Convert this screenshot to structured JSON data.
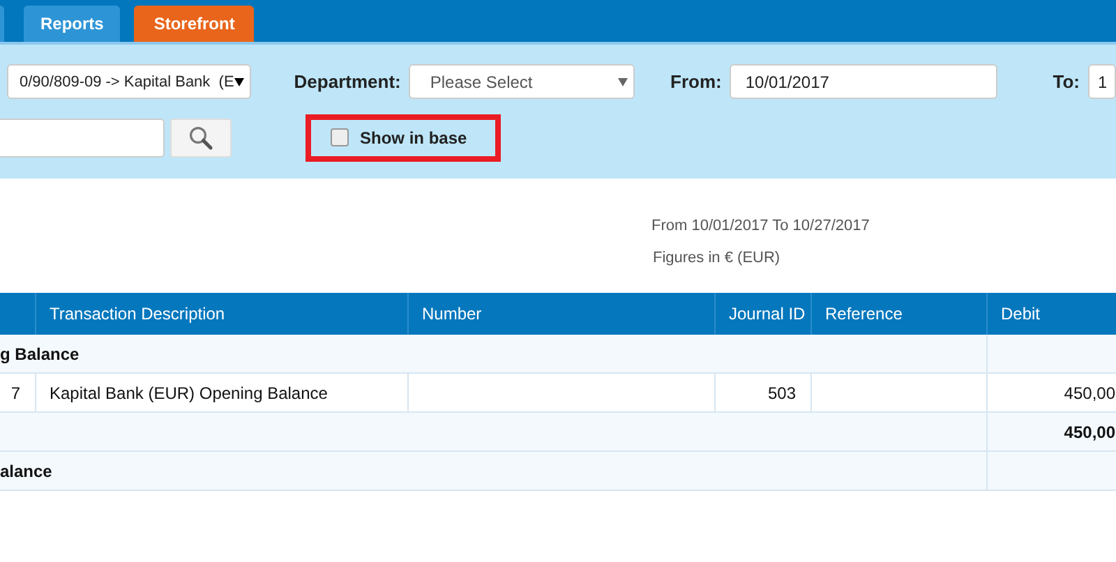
{
  "tabs": [
    {
      "selected": false
    },
    {
      "label": "Reports",
      "selected": false
    },
    {
      "label": "Storefront",
      "selected": true
    }
  ],
  "filters": {
    "account": {
      "value": "0/90/809-09 -> Kapital Bank  (E"
    },
    "department": {
      "label": "Department:",
      "value": "Please Select"
    },
    "from": {
      "label": "From:",
      "value": "10/01/2017"
    },
    "to": {
      "label": "To:",
      "value": "1"
    },
    "show_in_base": {
      "label": "Show in base",
      "checked": false,
      "highlighted": true
    }
  },
  "report": {
    "period": "From 10/01/2017 To 10/27/2017",
    "currency": "Figures in € (EUR)"
  },
  "table": {
    "columns": [
      "",
      "Transaction Description",
      "Number",
      "Journal ID",
      "Reference",
      "Debit"
    ],
    "rows": [
      {
        "kind": "group",
        "label": "g Balance"
      },
      {
        "kind": "entry",
        "cells": [
          "7",
          "Kapital Bank (EUR) Opening Balance",
          "",
          "503",
          "",
          "450,00"
        ]
      },
      {
        "kind": "total",
        "total": "450,00"
      },
      {
        "kind": "group",
        "label": "alance"
      }
    ]
  }
}
